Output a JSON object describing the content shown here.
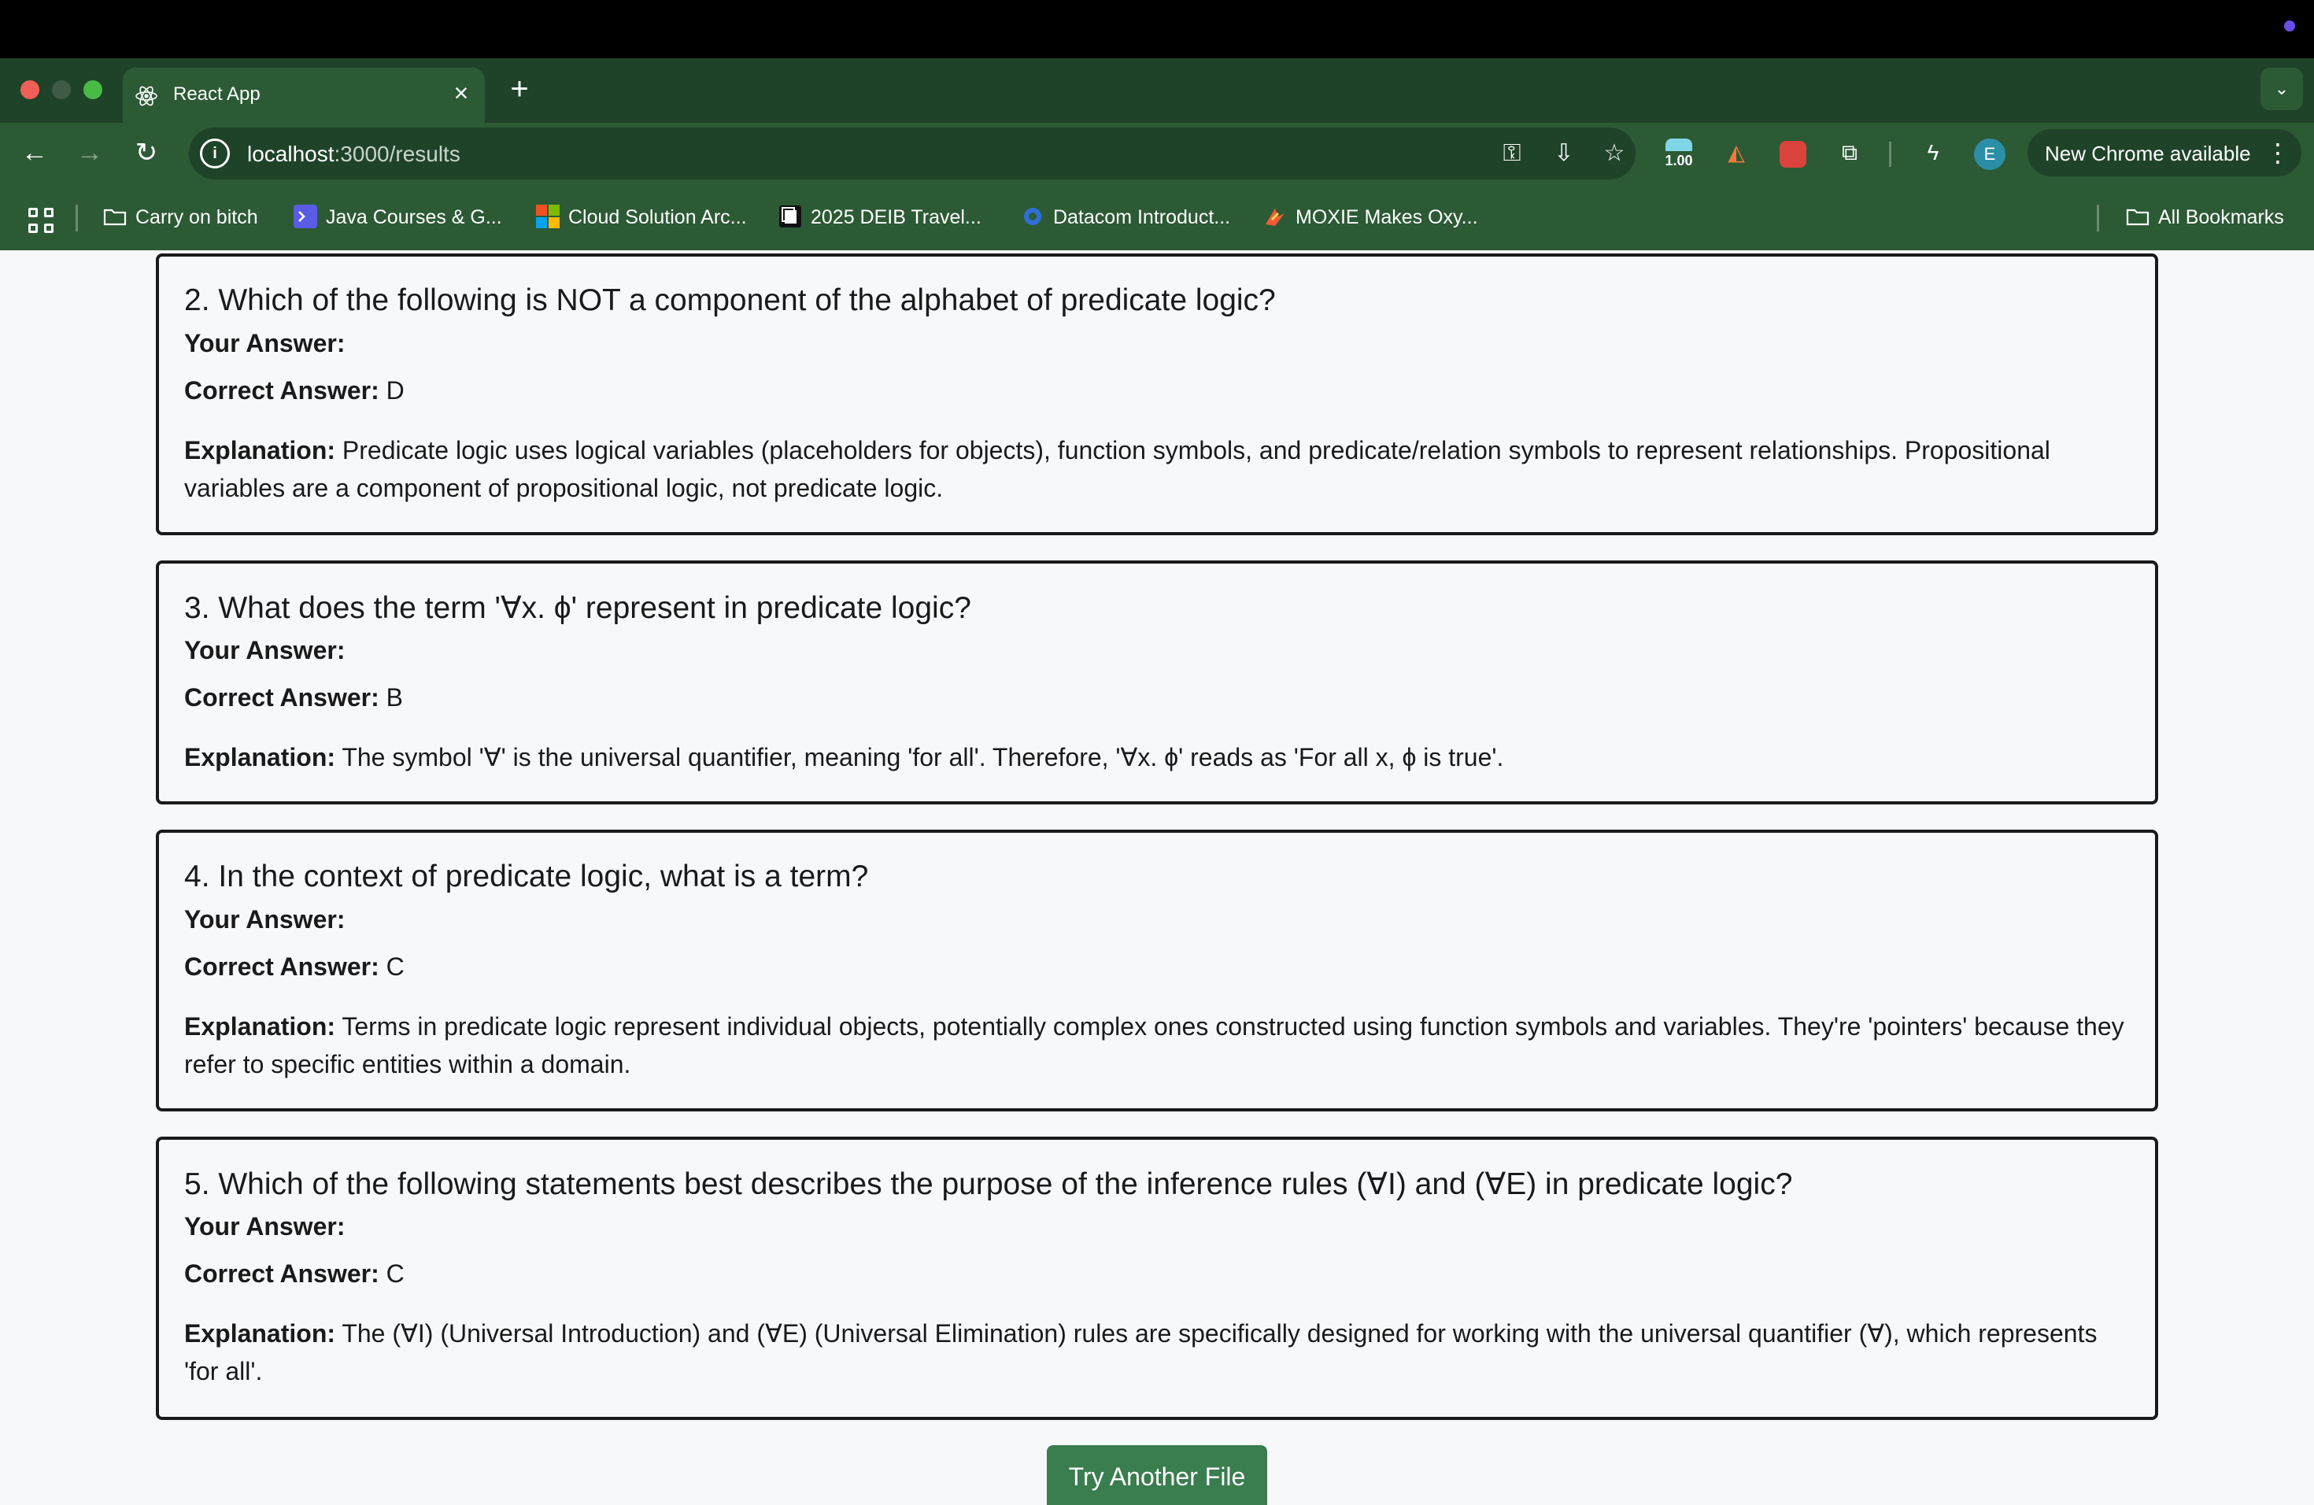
{
  "browser": {
    "tab_title": "React App",
    "url_host": "localhost",
    "url_path": ":3000/results",
    "extension_badge": "1.00",
    "profile_initial": "E",
    "update_label": "New Chrome available",
    "bookmarks": [
      {
        "label": "Carry on bitch",
        "icon": "folder-icon"
      },
      {
        "label": "Java Courses & G...",
        "icon": "terminal-icon"
      },
      {
        "label": "Cloud Solution Arc...",
        "icon": "microsoft-icon"
      },
      {
        "label": "2025 DEIB Travel...",
        "icon": "doc-icon"
      },
      {
        "label": "Datacom Introduct...",
        "icon": "datacom-icon"
      },
      {
        "label": "MOXIE Makes Oxy...",
        "icon": "moxie-icon"
      }
    ],
    "all_bookmarks": "All Bookmarks"
  },
  "labels": {
    "your_answer": "Your Answer:",
    "correct_answer": "Correct Answer:",
    "explanation": "Explanation:"
  },
  "questions": [
    {
      "question": "2. Which of the following is NOT a component of the alphabet of predicate logic?",
      "your_answer": "",
      "correct_answer": "D",
      "explanation": "Predicate logic uses logical variables (placeholders for objects), function symbols, and predicate/relation symbols to represent relationships. Propositional variables are a component of propositional logic, not predicate logic."
    },
    {
      "question": "3. What does the term '∀x. ϕ' represent in predicate logic?",
      "your_answer": "",
      "correct_answer": "B",
      "explanation": "The symbol '∀' is the universal quantifier, meaning 'for all'. Therefore, '∀x. ϕ' reads as 'For all x, ϕ is true'."
    },
    {
      "question": "4. In the context of predicate logic, what is a term?",
      "your_answer": "",
      "correct_answer": "C",
      "explanation": "Terms in predicate logic represent individual objects, potentially complex ones constructed using function symbols and variables. They're 'pointers' because they refer to specific entities within a domain."
    },
    {
      "question": "5. Which of the following statements best describes the purpose of the inference rules (∀I) and (∀E) in predicate logic?",
      "your_answer": "",
      "correct_answer": "C",
      "explanation": "The (∀I) (Universal Introduction) and (∀E) (Universal Elimination) rules are specifically designed for working with the universal quantifier (∀), which represents 'for all'."
    }
  ],
  "try_another_label": "Try Another File"
}
